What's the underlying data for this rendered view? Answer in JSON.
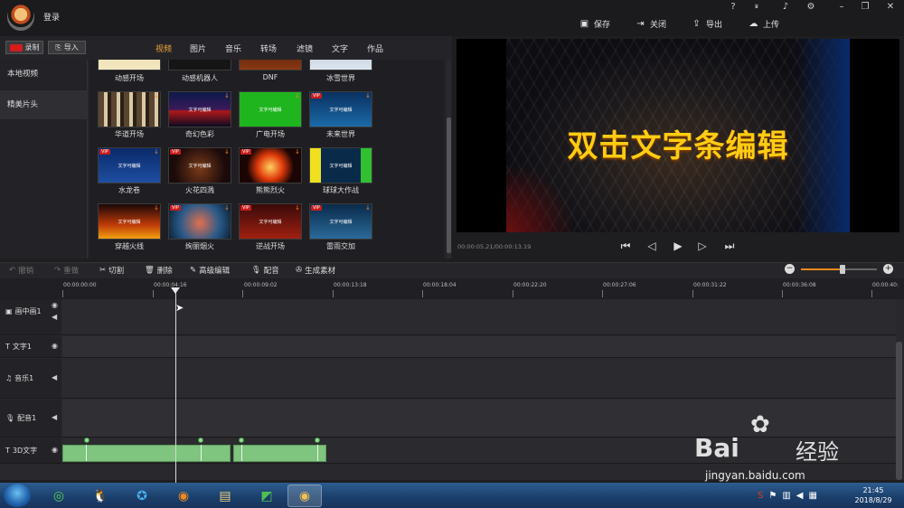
{
  "header": {
    "login": "登录",
    "window_buttons": [
      "?",
      "VIP",
      "bell",
      "gear",
      "min",
      "max",
      "close"
    ],
    "actions": [
      {
        "label": "保存",
        "icon": "save-icon"
      },
      {
        "label": "关闭",
        "icon": "exit-icon"
      },
      {
        "label": "导出",
        "icon": "export-icon"
      },
      {
        "label": "上传",
        "icon": "upload-icon"
      }
    ]
  },
  "library": {
    "record_label": "录制",
    "import_label": "导入",
    "tabs": [
      "视频",
      "图片",
      "音乐",
      "转场",
      "滤镜",
      "文字",
      "作品"
    ],
    "active_tab": "视频",
    "sidebar": [
      "本地视频",
      "精美片头"
    ],
    "selected_sidebar": "精美片头",
    "items": [
      {
        "label": "动感开场",
        "text": "",
        "vip": false
      },
      {
        "label": "动感机器人",
        "text": "",
        "vip": false
      },
      {
        "label": "DNF",
        "text": "",
        "vip": false
      },
      {
        "label": "冰雪世界",
        "text": "",
        "vip": false
      },
      {
        "label": "华道开场",
        "text": "",
        "vip": false
      },
      {
        "label": "奇幻色彩",
        "text": "文字可编辑",
        "vip": false
      },
      {
        "label": "广电开场",
        "text": "文字可编辑",
        "vip": false
      },
      {
        "label": "未来世界",
        "text": "文字可编辑",
        "vip": true
      },
      {
        "label": "水龙卷",
        "text": "文字可编辑",
        "vip": true
      },
      {
        "label": "火花四溅",
        "text": "文字可编辑",
        "vip": true
      },
      {
        "label": "熊熊烈火",
        "text": "",
        "vip": true
      },
      {
        "label": "球球大作战",
        "text": "文字可编辑",
        "vip": false
      },
      {
        "label": "穿越火线",
        "text": "文字可编辑",
        "vip": false
      },
      {
        "label": "绚丽烟火",
        "text": "",
        "vip": true
      },
      {
        "label": "逆战开场",
        "text": "文字可编辑",
        "vip": true
      },
      {
        "label": "雷雨交加",
        "text": "文字可编辑",
        "vip": true
      }
    ]
  },
  "preview": {
    "caption": "双击文字条编辑",
    "timecode": "00:00:05.21/00:00:13.19"
  },
  "toolbar": {
    "undo": "撤销",
    "redo": "重做",
    "cut": "切割",
    "delete": "删除",
    "advanced_edit": "高级编辑",
    "dub": "配音",
    "generate": "生成素材",
    "zoom_level": 0.55
  },
  "timeline": {
    "ticks": [
      "00:00:00:00",
      "00:00:04:16",
      "00:00:09:02",
      "00:00:13:18",
      "00:00:18:04",
      "00:00:22:20",
      "00:00:27:06",
      "00:00:31:22",
      "00:00:36:08",
      "00:00:40:"
    ],
    "tracks": [
      {
        "name": "画中画1",
        "icon": "pip-icon"
      },
      {
        "name": "文字1",
        "icon": "text-icon"
      },
      {
        "name": "音乐1",
        "icon": "music-icon"
      },
      {
        "name": "配音1",
        "icon": "mic-icon"
      },
      {
        "name": "3D文字",
        "icon": "text3d-icon"
      }
    ]
  },
  "taskbar": {
    "time": "21:45",
    "date": "2018/8/29"
  },
  "watermark": {
    "brand": "Bai",
    "brand_cn": "经验",
    "url": "jingyan.baidu.com"
  }
}
